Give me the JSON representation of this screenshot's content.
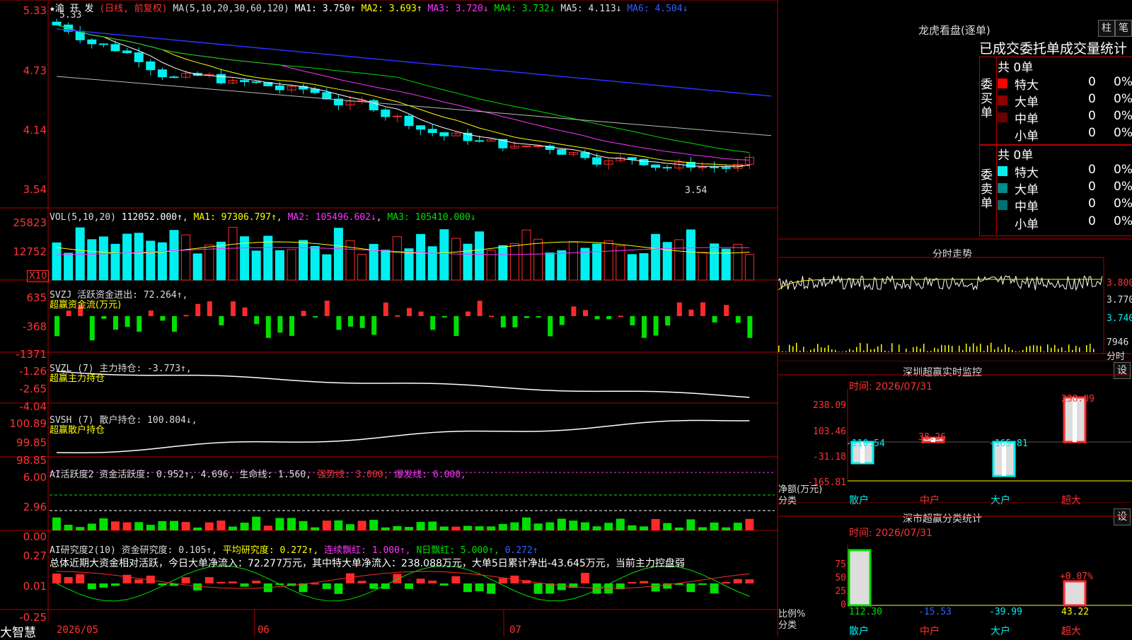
{
  "colors": {
    "up": "#ff2a2a",
    "down": "#00f0f0",
    "grid": "#b00000",
    "white": "#ffffff",
    "yellow": "#ffff00",
    "magenta": "#ff33ff",
    "green": "#00e000",
    "blue": "#3030ff",
    "gray": "#bbbbbb"
  },
  "brand": "大智慧",
  "main": {
    "stock": "★渝 开 发",
    "period": "(日线, 前复权)",
    "ma_label": "MA(5,10,20,30,60,120)",
    "ma": [
      {
        "name": "MA1:",
        "value": "3.750↑"
      },
      {
        "name": "MA2:",
        "value": "3.693↑"
      },
      {
        "name": "MA3:",
        "value": "3.720↓"
      },
      {
        "name": "MA4:",
        "value": "3.732↓"
      },
      {
        "name": "MA5:",
        "value": "4.113↓"
      },
      {
        "name": "MA6:",
        "value": "4.504↓"
      }
    ],
    "high_label": "5.33",
    "low_label": "3.54",
    "yaxis": [
      "5.33",
      "4.73",
      "4.14",
      "3.54"
    ]
  },
  "vol": {
    "label": "VOL(5,10,20)",
    "value": "112052.000↑",
    "ma1": "MA1: 97306.797↑",
    "ma2": "MA2: 105496.602↓",
    "ma3": "MA3: 105410.000↓",
    "yaxis": [
      "25823",
      "12752"
    ],
    "unit": "X10"
  },
  "svzj": {
    "label": "SVZJ  活跃资金进出: 72.264↑,",
    "sub": "超赢资金流(万元)",
    "yaxis": [
      "635",
      "-368",
      "-1371"
    ]
  },
  "svzl": {
    "label": "SVZL (7) 主力持仓: -3.773↑,",
    "sub": "超赢主力持仓",
    "yaxis": [
      "-1.26",
      "-2.65",
      "-4.04"
    ]
  },
  "svsh": {
    "label": "SVSH (7) 散户持仓: 100.804↓,",
    "sub": "超赢散户持仓",
    "yaxis": [
      "100.89",
      "99.85",
      "98.85"
    ]
  },
  "ai1": {
    "label": "AI活跃度2 资金活跃度: 0.952↑, 4.696, 生命线: 1.560,",
    "strong": "强势线: 3.000,",
    "burst": "爆发线: 6.000,",
    "yaxis": [
      "6.00",
      "2.96",
      "0.00"
    ]
  },
  "ai2": {
    "label": "AI研究度2(10) 资金研究度: 0.105↑,",
    "avg": "平均研究度: 0.272↑,",
    "cont": "连续飘红: 1.000↑,",
    "nday": "N日飘红: 5.000↑,",
    "last": "0.272↑",
    "summary": "总体近期大资金相对活跃，今日大单净流入：72.277万元，其中特大单净流入：238.088万元，大单5日累计净出-43.645万元，当前主力控盘弱",
    "yaxis": [
      "0.27",
      "0.01",
      "-0.25"
    ]
  },
  "dates": [
    "2026/05",
    "06",
    "07"
  ],
  "right": {
    "title": "龙虎看盘(逐单)",
    "btn1": "柱",
    "btn2": "笔",
    "table_title": "已成交委托单成交量统计",
    "buy_group": "委买单",
    "sell_group": "委卖单",
    "buy_total": "共 0单",
    "sell_total": "共 0单",
    "rows": [
      {
        "name": "特大",
        "count": "0",
        "pct": "0%"
      },
      {
        "name": "大单",
        "count": "0",
        "pct": "0%"
      },
      {
        "name": "中单",
        "count": "0",
        "pct": "0%"
      },
      {
        "name": "小单",
        "count": "0",
        "pct": "0%"
      }
    ],
    "timeshare_title": "分时走势",
    "ts_yaxis": [
      "3.800",
      "3.770",
      "3.740"
    ],
    "ts_vol": "7946",
    "ts_unit": "分时",
    "monitor_title": "深圳超赢实时监控",
    "settings": "设",
    "monitor_time": "时间: 2026/07/31",
    "monitor_yaxis": [
      "238.09",
      "103.46",
      "-31.18",
      "-165.81"
    ],
    "monitor_values": [
      "-110.54",
      "38.26",
      "-165.81",
      "238.09"
    ],
    "monitor_unit": "净额(万元)",
    "monitor_unit2": "分类",
    "cats": [
      "散户",
      "中户",
      "大户",
      "超大"
    ],
    "cls_title": "深市超赢分类统计",
    "cls_time": "时间: 2026/07/31",
    "cls_yaxis": [
      "75",
      "50",
      "25",
      "0"
    ],
    "cls_values": [
      "112.30",
      "-15.53",
      "-39.99",
      "43.22"
    ],
    "cls_pct": "+0.07%",
    "cls_unit": "比例%",
    "cls_unit2": "分类"
  }
}
